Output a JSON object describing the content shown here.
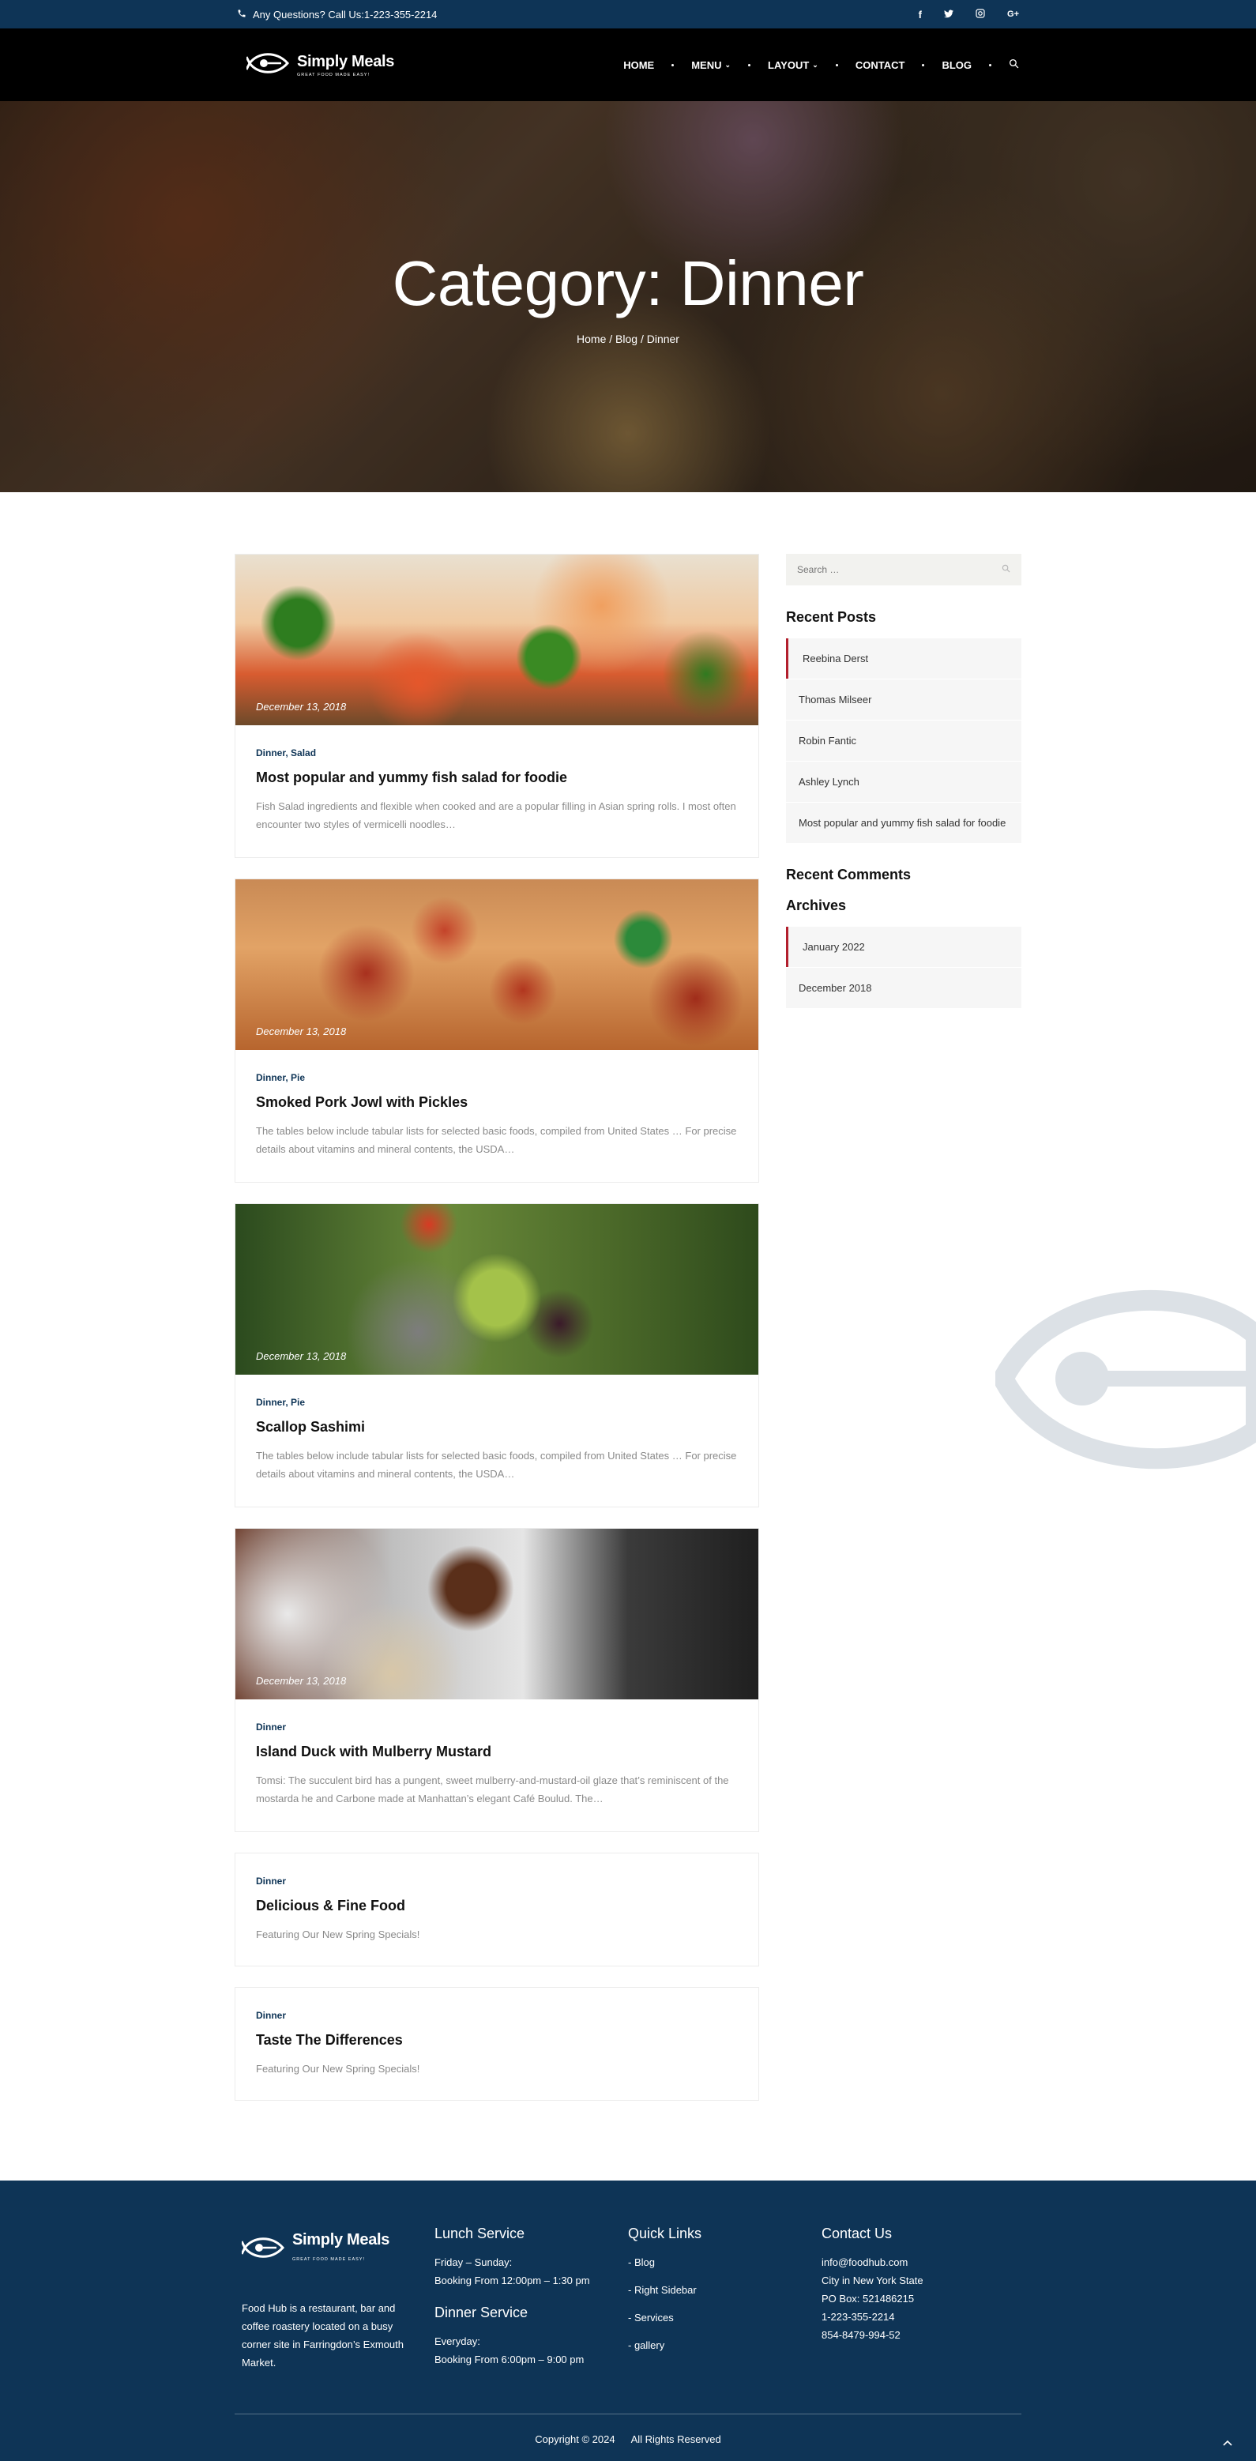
{
  "topbar": {
    "phone_text": "Any Questions? Call Us:1-223-355-2214",
    "social": [
      "f",
      "t",
      "ig",
      "G+"
    ]
  },
  "header": {
    "brand_name": "Simply Meals",
    "brand_tagline": "GREAT FOOD MADE EASY!",
    "nav": [
      "HOME",
      "MENU",
      "LAYOUT",
      "CONTACT",
      "BLOG"
    ]
  },
  "hero": {
    "title": "Category: Dinner",
    "breadcrumb": "Home / Blog / Dinner"
  },
  "posts": [
    {
      "date": "December 13, 2018",
      "categories": "Dinner, Salad",
      "title": "Most popular and yummy fish salad for foodie",
      "excerpt": "Fish Salad ingredients and flexible when cooked and are a popular filling in Asian spring rolls. I most often encounter two styles of vermicelli noodles…"
    },
    {
      "date": "December 13, 2018",
      "categories": "Dinner, Pie",
      "title": "Smoked Pork Jowl with Pickles",
      "excerpt": "The tables below include tabular lists for selected basic foods, compiled from United States … For precise details about vitamins and mineral contents, the USDA…"
    },
    {
      "date": "December 13, 2018",
      "categories": "Dinner, Pie",
      "title": "Scallop Sashimi",
      "excerpt": "The tables below include tabular lists for selected basic foods, compiled from United States … For precise details about vitamins and mineral contents, the USDA…"
    },
    {
      "date": "December 13, 2018",
      "categories": "Dinner",
      "title": "Island Duck with Mulberry Mustard",
      "excerpt": "Tomsi: The succulent bird has a pungent, sweet mulberry-and-mustard-oil glaze that’s reminiscent of the mostarda he and Carbone made at Manhattan’s elegant Café Boulud. The…"
    },
    {
      "categories": "Dinner",
      "title": "Delicious & Fine Food",
      "excerpt": "Featuring Our New Spring Specials!"
    },
    {
      "categories": "Dinner",
      "title": "Taste The Differences",
      "excerpt": "Featuring Our New Spring Specials!"
    }
  ],
  "sidebar": {
    "search_placeholder": "Search …",
    "recent_posts_title": "Recent Posts",
    "recent_posts": [
      "Reebina Derst",
      "Thomas Milseer",
      "Robin Fantic",
      "Ashley Lynch",
      "Most popular and yummy fish salad for foodie"
    ],
    "recent_comments_title": "Recent Comments",
    "archives_title": "Archives",
    "archives": [
      "January 2022",
      "December 2018"
    ]
  },
  "footer": {
    "about": "Food Hub is a restaurant, bar and coffee roastery located on a busy corner site in Farringdon’s Exmouth Market.",
    "lunch_title": "Lunch Service",
    "lunch_days": "Friday – Sunday:",
    "lunch_hours": "Booking From 12:00pm – 1:30 pm",
    "dinner_title": "Dinner Service",
    "dinner_days": "Everyday:",
    "dinner_hours": "Booking From 6:00pm – 9:00 pm",
    "links_title": "Quick Links",
    "links": [
      "- Blog",
      "- Right Sidebar",
      "- Services",
      "- gallery"
    ],
    "contact_title": "Contact Us",
    "contact": [
      "info@foodhub.com",
      "City in New York State",
      "PO Box: 521486215",
      "1-223-355-2214",
      "854-8479-994-52"
    ],
    "copyright": "Copyright © 2024",
    "rights": "All Rights Reserved"
  },
  "colors": {
    "navy": "#0e3456",
    "accent_red": "#b21f2d",
    "header_black": "#000000"
  }
}
